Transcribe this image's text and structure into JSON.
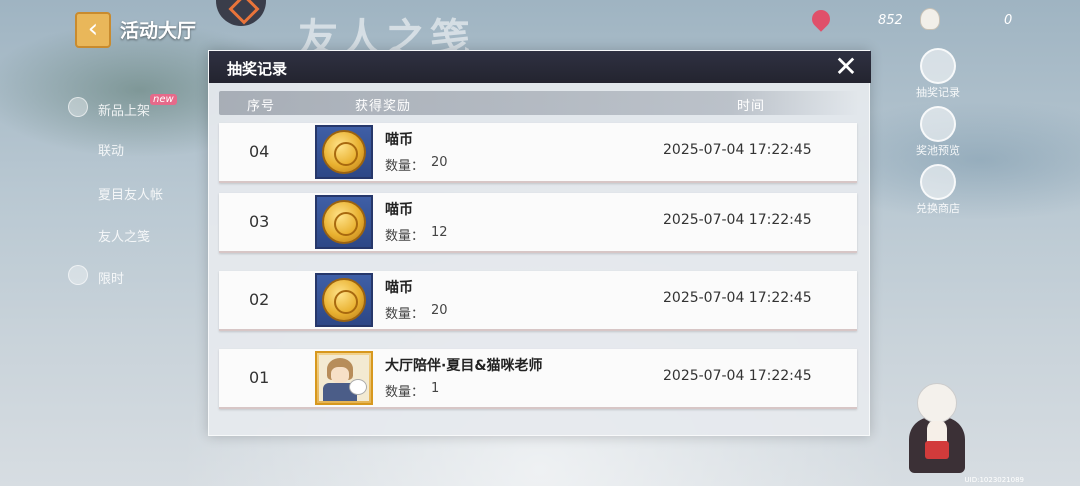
{
  "background": {
    "hall_title": "活动大厅",
    "event_title": "友人之笺",
    "currency_1": "852",
    "currency_2": "0",
    "left_menu": [
      {
        "label": "新品上架",
        "badge": "new"
      },
      {
        "label": "联动"
      },
      {
        "label": "夏目友人帐"
      },
      {
        "label": "友人之笺"
      },
      {
        "label": "限时"
      }
    ],
    "right_menu": [
      {
        "label": "抽奖记录",
        "icon": "cat-icon"
      },
      {
        "label": "奖池预览",
        "icon": "scroll-icon"
      },
      {
        "label": "兑换商店",
        "icon": "shop-icon"
      }
    ],
    "uid": "UID:1023021089"
  },
  "modal": {
    "title": "抽奖记录",
    "close_icon": "close-icon",
    "columns": {
      "index": "序号",
      "reward": "获得奖励",
      "time": "时间"
    },
    "qty_label": "数量：",
    "rows": [
      {
        "index": "04",
        "name": "喵币",
        "qty": "20",
        "time": "2025-07-04 17:22:45",
        "icon": "coin-icon"
      },
      {
        "index": "03",
        "name": "喵币",
        "qty": "12",
        "time": "2025-07-04 17:22:45",
        "icon": "coin-icon"
      },
      {
        "index": "02",
        "name": "喵币",
        "qty": "20",
        "time": "2025-07-04 17:22:45",
        "icon": "coin-icon"
      },
      {
        "index": "01",
        "name": "大厅陪伴·夏目&猫咪老师",
        "qty": "1",
        "time": "2025-07-04 17:22:45",
        "icon": "portrait-icon"
      }
    ]
  }
}
